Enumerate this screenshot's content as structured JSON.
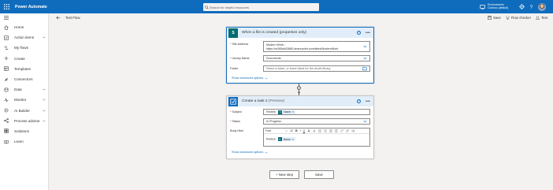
{
  "app": {
    "title": "Power Automate"
  },
  "search": {
    "placeholder": "Search for helpful resources"
  },
  "environment": {
    "label": "Environments",
    "name": "Contoso (default)"
  },
  "sidebar": {
    "items": [
      {
        "label": "Home",
        "icon": "home-icon"
      },
      {
        "label": "Action items",
        "icon": "checklist-icon",
        "expandable": true
      },
      {
        "label": "My flows",
        "icon": "flow-icon"
      },
      {
        "label": "Create",
        "icon": "plus-icon"
      },
      {
        "label": "Templates",
        "icon": "templates-icon"
      },
      {
        "label": "Connectors",
        "icon": "connectors-icon"
      },
      {
        "label": "Data",
        "icon": "data-icon",
        "expandable": true
      },
      {
        "label": "Monitor",
        "icon": "monitor-icon",
        "expandable": true
      },
      {
        "label": "AI Builder",
        "icon": "ai-builder-icon",
        "expandable": true
      },
      {
        "label": "Process advisor",
        "icon": "process-advisor-icon",
        "expandable": true
      },
      {
        "label": "Solutions",
        "icon": "solutions-icon"
      },
      {
        "label": "Learn",
        "icon": "learn-icon"
      }
    ]
  },
  "header": {
    "flow_name": "Test Flow"
  },
  "commands": {
    "save": "Save",
    "flow_checker": "Flow checker",
    "test": "Test"
  },
  "trigger": {
    "title": "When a file is created (properties only)",
    "site_address_label": "Site Address",
    "site_address_line1": "Modern Work -",
    "site_address_line2": "https://m365x843880.sharepoint.com/sites/ModernWork",
    "library_label": "Library Name",
    "library_value": "Documents",
    "folder_label": "Folder",
    "folder_placeholder": "Select a folder, or leave blank for the whole library",
    "advanced": "Show advanced options"
  },
  "action": {
    "title": "Create a task 2",
    "preview": "(Preview)",
    "subject_label": "Subject",
    "subject_text": "Review",
    "subject_token": "Name",
    "status_label": "Status",
    "status_value": "In Progress",
    "body_label": "Body Html",
    "toolbar_font": "Font",
    "toolbar_size": "12",
    "body_text": "Review",
    "body_token": "Name",
    "advanced": "Show advanced options"
  },
  "buttons": {
    "new_step": "+ New step",
    "save": "Save"
  },
  "colors": {
    "accent": "#0f6cbd",
    "sharepoint": "#036c70",
    "required": "#a4262c"
  }
}
